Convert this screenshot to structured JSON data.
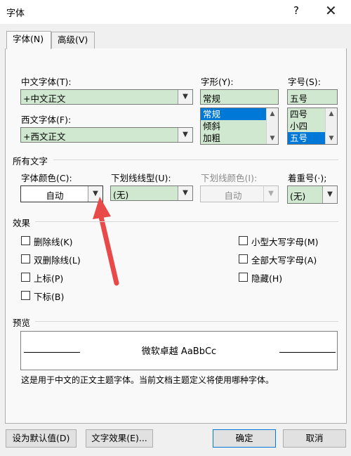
{
  "window": {
    "title": "字体",
    "help": "?",
    "close": "✕"
  },
  "tabs": [
    {
      "label": "字体(N)"
    },
    {
      "label": "高级(V)"
    }
  ],
  "font": {
    "chinese_label": "中文字体(T):",
    "chinese_value": "+中文正文",
    "western_label": "西文字体(F):",
    "western_value": "+西文正文",
    "style_label": "字形(Y):",
    "style_value": "常规",
    "style_options": [
      "常规",
      "倾斜",
      "加粗"
    ],
    "size_label": "字号(S):",
    "size_value": "五号",
    "size_options": [
      "四号",
      "小四",
      "五号"
    ]
  },
  "all_text": {
    "section": "所有文字",
    "color_label": "字体颜色(C):",
    "color_value": "自动",
    "underline_label": "下划线线型(U):",
    "underline_value": "(无)",
    "underline_color_label": "下划线颜色(I):",
    "underline_color_value": "自动",
    "emphasis_label": "着重号(·);",
    "emphasis_value": "(无)"
  },
  "effects": {
    "section": "效果",
    "left": [
      "删除线(K)",
      "双删除线(L)",
      "上标(P)",
      "下标(B)"
    ],
    "right": [
      "小型大写字母(M)",
      "全部大写字母(A)",
      "隐藏(H)"
    ]
  },
  "preview": {
    "section": "预览",
    "sample": "微软卓越  AaBbCc",
    "note": "这是用于中文的正文主题字体。当前文档主题定义将使用哪种字体。"
  },
  "buttons": {
    "default": "设为默认值(D)",
    "text_effects": "文字效果(E)...",
    "ok": "确定",
    "cancel": "取消"
  },
  "colors": {
    "field_green": "#cfe8cf",
    "selection": "#0078d7",
    "annotation_arrow": "#e84a4a"
  }
}
